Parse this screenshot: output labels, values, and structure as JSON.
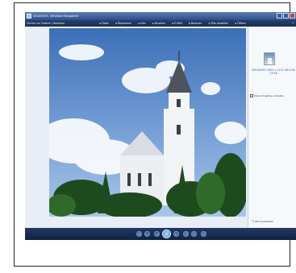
{
  "window": {
    "title": "DSC00053 - Windows Fotogalerie",
    "controls": [
      "minimize",
      "maximize",
      "close"
    ]
  },
  "menubar": {
    "back_label": "Zurück zur Galerie | Vorschau",
    "menus": [
      "Datei",
      "Reparieren",
      "Info",
      "Drucken",
      "E-Mail",
      "Brennen",
      "Film erstellen",
      "Öffnen"
    ],
    "help_icon": "help-icon"
  },
  "info_pane": {
    "file_info": "DSC00053\n1632 x 1224\n46-4-08 13:46",
    "checkbox_label": "Datei-Vorgänge erstellen",
    "link_label": "Bild bearbeiten"
  },
  "playback": {
    "buttons": [
      "zoom",
      "fit",
      "previous",
      "play",
      "next",
      "rotate-left",
      "rotate-right",
      "delete"
    ]
  },
  "colors": {
    "titlebar": "#2d4d86",
    "toolbar": "#172c52",
    "controls": "#10213f",
    "link": "#2a63b8"
  }
}
